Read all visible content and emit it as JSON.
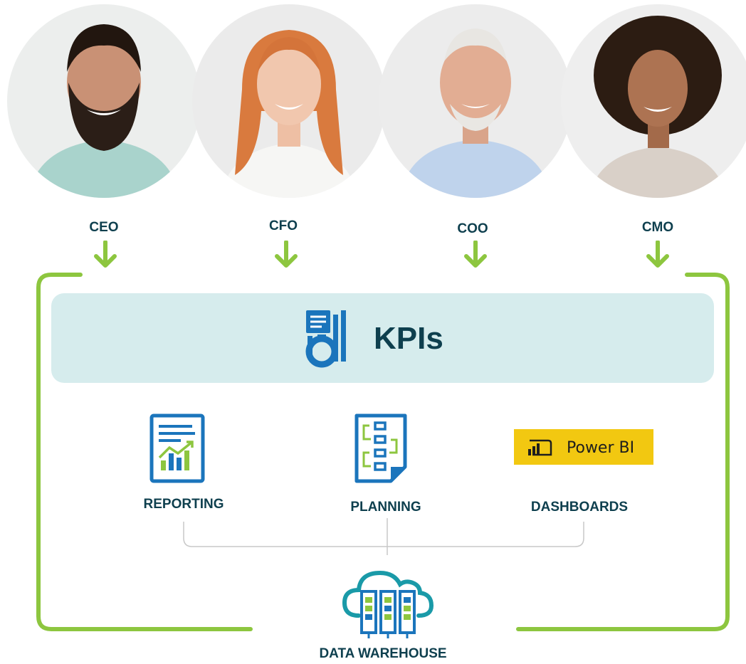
{
  "roles": [
    {
      "label": "CEO"
    },
    {
      "label": "CFO"
    },
    {
      "label": "COO"
    },
    {
      "label": "CMO"
    }
  ],
  "kpi": {
    "title": "KPIs",
    "icon": "kpi-report-icon"
  },
  "tools": {
    "reporting": {
      "label": "REPORTING",
      "icon": "report-chart-icon"
    },
    "planning": {
      "label": "PLANNING",
      "icon": "workflow-document-icon"
    },
    "dashboards": {
      "label": "DASHBOARDS",
      "logo_text": "Power BI",
      "icon": "powerbi-logo"
    }
  },
  "warehouse": {
    "label": "DATA WAREHOUSE",
    "icon": "cloud-server-icon"
  },
  "colors": {
    "accent_green": "#8dc63f",
    "kpi_band": "#d6eced",
    "text_dark": "#0e3f4e",
    "icon_blue": "#1b75bc",
    "powerbi_yellow": "#f2c811"
  }
}
